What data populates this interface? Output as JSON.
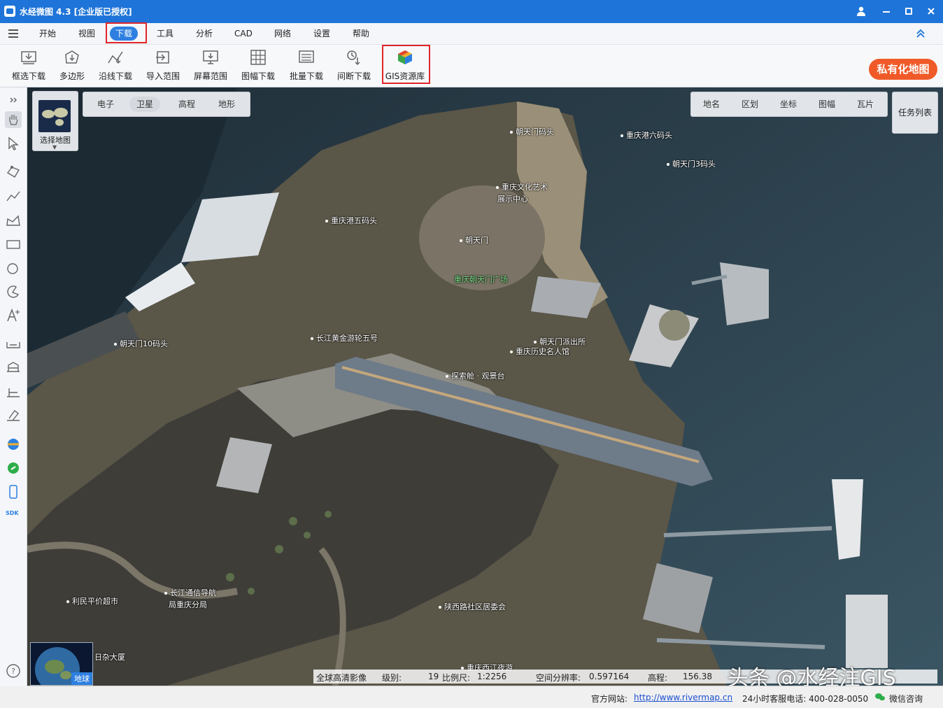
{
  "window": {
    "title": "水经微图 4.3 [企业版已授权]"
  },
  "menu": {
    "items": [
      "开始",
      "视图",
      "下载",
      "工具",
      "分析",
      "CAD",
      "网络",
      "设置",
      "帮助"
    ],
    "active": "下载"
  },
  "toolbar": {
    "tools": [
      "框选下载",
      "多边形",
      "沿线下载",
      "导入范围",
      "屏幕范围",
      "图幅下载",
      "批量下载",
      "间断下载",
      "GIS资源库"
    ],
    "private_map": "私有化地图"
  },
  "map": {
    "select_map_label": "选择地图",
    "type_tabs": [
      "电子",
      "卫星",
      "高程",
      "地形"
    ],
    "active_type": "卫星",
    "overlay_tabs": [
      "地名",
      "区划",
      "坐标",
      "图幅",
      "瓦片"
    ],
    "task_list": "任务列表",
    "globe_label": "地球",
    "labels": {
      "l01": "朝天门码头",
      "l02": "重庆港六码头",
      "l03": "朝天门3码头",
      "l04": "重庆文化艺术",
      "l04b": "展示中心",
      "l05": "重庆港五码头",
      "l06": "朝天门",
      "l07": "重庆朝天门广场",
      "l08": "朝天门派出所",
      "l09": "重庆历史名人馆",
      "l10": "长江黄金游轮五号",
      "l11": "朝天门10码头",
      "l12": "探索舱 · 观景台",
      "l13": "利民平价超市",
      "l14": "长江通信导航",
      "l14b": "局重庆分局",
      "l15": "陕西路社区居委会",
      "l16": "日杂大厦",
      "l17": "重庆西江夜游"
    },
    "info": {
      "source": "全球高清影像",
      "level_label": "级别:",
      "level": "19",
      "scale_label": "比例尺:",
      "scale": "1:2256",
      "resolution_label": "空间分辨率:",
      "resolution": "0.597164",
      "elevation_label": "高程:",
      "elevation": "156.38"
    },
    "watermark": "头条 @水经注GIS"
  },
  "status": {
    "website_label": "官方网站:",
    "website": "http://www.rivermap.cn",
    "phone": "24小时客服电话: 400-028-0050",
    "wechat": "微信咨询"
  }
}
